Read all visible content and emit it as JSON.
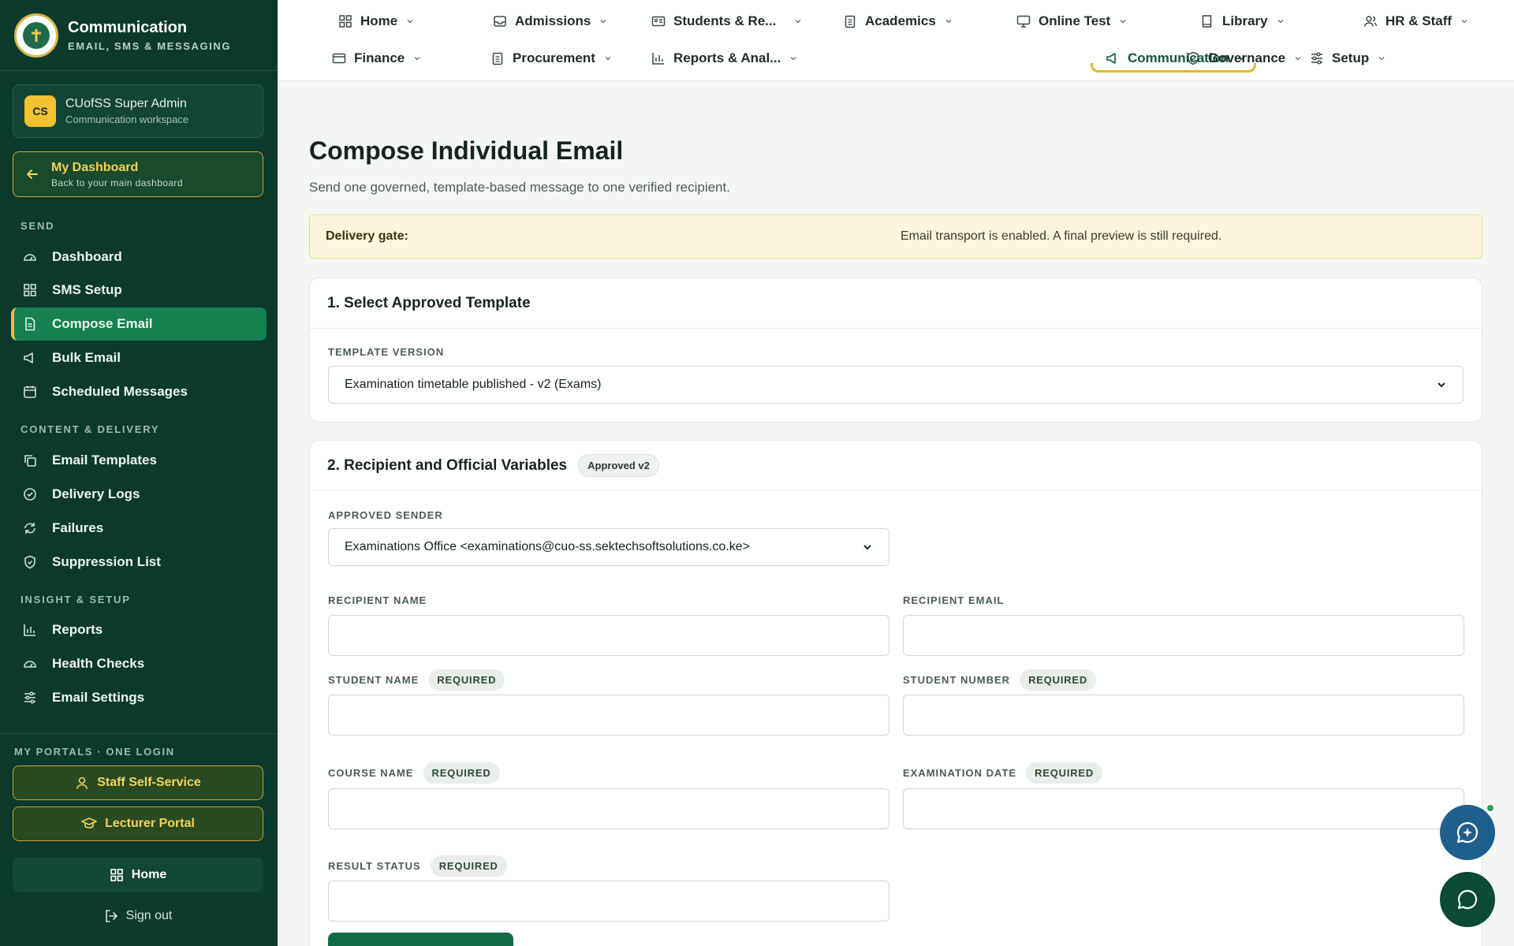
{
  "brand": {
    "title": "Communication",
    "subtitle": "EMAIL, SMS & MESSAGING"
  },
  "user": {
    "initials": "CS",
    "name": "CUofSS Super Admin",
    "role": "Communication workspace"
  },
  "dashboard_link": {
    "title": "My Dashboard",
    "subtitle": "Back to your main dashboard"
  },
  "sidebar": {
    "sections": [
      {
        "label": "SEND"
      },
      {
        "label": "CONTENT & DELIVERY"
      },
      {
        "label": "INSIGHT & SETUP"
      }
    ],
    "items": [
      {
        "label": "Dashboard",
        "icon": "gauge-icon"
      },
      {
        "label": "SMS Setup",
        "icon": "grid-icon"
      },
      {
        "label": "Compose Email",
        "icon": "document-icon",
        "active": true
      },
      {
        "label": "Bulk Email",
        "icon": "megaphone-icon"
      },
      {
        "label": "Scheduled Messages",
        "icon": "calendar-icon"
      },
      {
        "label": "Email Templates",
        "icon": "copy-icon"
      },
      {
        "label": "Delivery Logs",
        "icon": "check-circle-icon"
      },
      {
        "label": "Failures",
        "icon": "refresh-icon"
      },
      {
        "label": "Suppression List",
        "icon": "shield-check-icon"
      },
      {
        "label": "Reports",
        "icon": "bar-chart-icon"
      },
      {
        "label": "Health Checks",
        "icon": "gauge-icon"
      },
      {
        "label": "Email Settings",
        "icon": "sliders-icon"
      }
    ],
    "portals_label": "MY PORTALS · ONE LOGIN",
    "portals": [
      {
        "label": "Staff Self-Service",
        "icon": "user-icon"
      },
      {
        "label": "Lecturer Portal",
        "icon": "graduation-cap-icon"
      }
    ],
    "home_label": "Home",
    "signout_label": "Sign out"
  },
  "topnav": {
    "items": [
      {
        "label": "Home",
        "icon": "grid-icon"
      },
      {
        "label": "Admissions",
        "icon": "inbox-icon"
      },
      {
        "label": "Students & Re...",
        "icon": "id-card-icon"
      },
      {
        "label": "Academics",
        "icon": "clipboard-icon"
      },
      {
        "label": "Online Test",
        "icon": "monitor-icon"
      },
      {
        "label": "Library",
        "icon": "book-icon"
      },
      {
        "label": "HR & Staff",
        "icon": "users-icon"
      },
      {
        "label": "Finance",
        "icon": "wallet-icon"
      },
      {
        "label": "Procurement",
        "icon": "clipboard-icon"
      },
      {
        "label": "Reports & Anal...",
        "icon": "bar-chart-icon"
      },
      {
        "label": "Communication",
        "icon": "megaphone-icon",
        "active": true
      },
      {
        "label": "Setup",
        "icon": "sliders-icon"
      },
      {
        "label": "Governance",
        "icon": "shield-check-icon"
      }
    ]
  },
  "page": {
    "title": "Compose Individual Email",
    "subtitle": "Send one governed, template-based message to one verified recipient."
  },
  "gate": {
    "label": "Delivery gate:",
    "text": "Email transport is enabled. A final preview is still required."
  },
  "section1": {
    "title": "1. Select Approved Template",
    "template_label": "TEMPLATE VERSION",
    "template_value": "Examination timetable published - v2 (Exams)"
  },
  "section2": {
    "title": "2. Recipient and Official Variables",
    "badge": "Approved v2",
    "sender_label": "APPROVED SENDER",
    "sender_value": "Examinations Office <examinations@cuo-ss.sektechsoftsolutions.co.ke>",
    "required_tag": "REQUIRED",
    "fields": {
      "recipient_name": {
        "label": "RECIPIENT NAME",
        "value": ""
      },
      "recipient_email": {
        "label": "RECIPIENT EMAIL",
        "value": ""
      },
      "student_name": {
        "label": "STUDENT NAME",
        "value": ""
      },
      "student_number": {
        "label": "STUDENT NUMBER",
        "value": ""
      },
      "course_name": {
        "label": "COURSE NAME",
        "value": ""
      },
      "examination_date": {
        "label": "EXAMINATION DATE",
        "value": ""
      },
      "result_status": {
        "label": "RESULT STATUS",
        "value": ""
      }
    }
  },
  "colors": {
    "sidebar_bg": "#0b3a2d",
    "active_green": "#16804f",
    "accent_gold": "#e0b92a",
    "gate_bg": "#fdf6dc"
  }
}
